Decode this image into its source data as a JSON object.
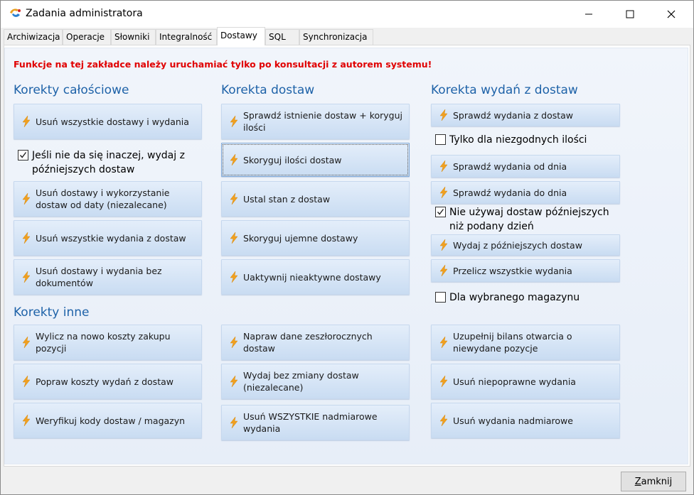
{
  "window": {
    "title": "Zadania administratora",
    "close_button": {
      "accel": "Z",
      "rest": "amknij"
    }
  },
  "tabs": [
    {
      "label": "Archiwizacja",
      "active": false
    },
    {
      "label": "Operacje",
      "active": false
    },
    {
      "label": "Słowniki",
      "active": false
    },
    {
      "label": "Integralność",
      "active": false
    },
    {
      "label": "Dostawy",
      "active": true
    },
    {
      "label": "SQL",
      "active": false
    },
    {
      "label": "Synchronizacja",
      "active": false
    }
  ],
  "warning": "Funkcje na tej zakładce należy uruchamiać tylko po konsultacji z autorem systemu!",
  "groups": {
    "korekty_calosciowe": {
      "title": "Korekty całościowe",
      "buttons": [
        "Usuń wszystkie dostawy i wydania",
        "Usuń dostawy i wykorzystanie dostaw od daty (niezalecane)",
        "Usuń wszystkie wydania z dostaw",
        "Usuń dostawy i wydania bez dokumentów"
      ],
      "checkbox": {
        "label": "Jeśli nie da się inaczej, wydaj z późniejszych dostaw",
        "checked": true
      }
    },
    "korekta_dostaw": {
      "title": "Korekta dostaw",
      "buttons": [
        "Sprawdź istnienie dostaw + koryguj ilości",
        "Skoryguj ilości dostaw",
        "Ustal stan z dostaw",
        "Skoryguj ujemne dostawy",
        "Uaktywnij nieaktywne dostawy"
      ]
    },
    "korekta_wydan": {
      "title": "Korekta wydań z dostaw",
      "buttons": [
        "Sprawdź wydania z dostaw",
        "Sprawdź wydania od dnia",
        "Sprawdź wydania do dnia",
        "Wydaj z późniejszych dostaw",
        "Przelicz wszystkie wydania"
      ],
      "checkboxes": [
        {
          "label": "Tylko dla niezgodnych ilości",
          "checked": false
        },
        {
          "label": "Nie używaj dostaw późniejszych niż podany dzień",
          "checked": true
        },
        {
          "label": "Dla wybranego magazynu",
          "checked": false
        }
      ]
    },
    "korekty_inne": {
      "title": "Korekty inne",
      "col1": [
        "Wylicz na nowo koszty zakupu pozycji",
        "Popraw koszty wydań z dostaw",
        "Weryfikuj kody dostaw / magazyn"
      ],
      "col2": [
        "Napraw dane zeszłorocznych dostaw",
        "Wydaj bez zmiany dostaw (niezalecane)",
        "Usuń WSZYSTKIE nadmiarowe wydania"
      ],
      "col3": [
        "Uzupełnij bilans otwarcia o niewydane pozycje",
        "Usuń niepoprawne wydania",
        "Usuń wydania nadmiarowe"
      ]
    }
  },
  "colors": {
    "group_title": "#1e62a8",
    "warning": "#e00000",
    "bolt": "#f0a020"
  }
}
